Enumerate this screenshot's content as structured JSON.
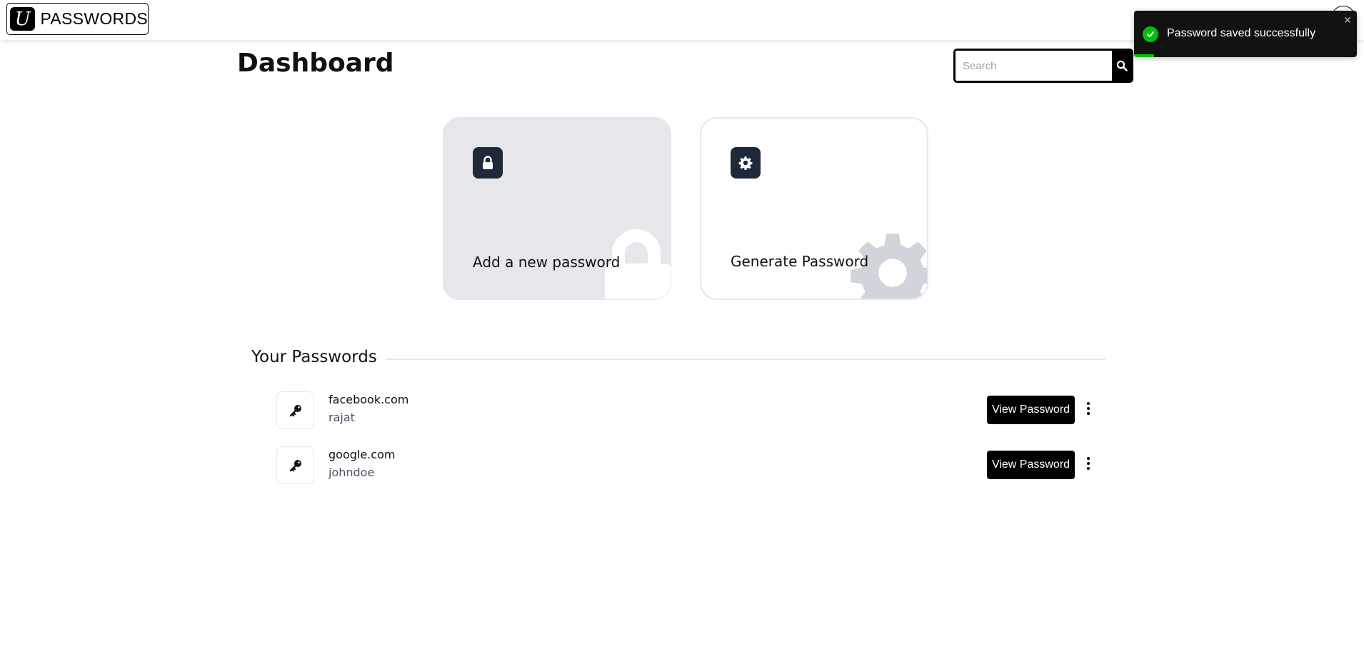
{
  "header": {
    "logo_letter": "U",
    "logo_text": "PASSWORDS"
  },
  "page": {
    "title": "Dashboard"
  },
  "search": {
    "placeholder": "Search",
    "value": "",
    "button_icon": "search-icon"
  },
  "cards": [
    {
      "label": "Add a new password",
      "icon": "lock-icon"
    },
    {
      "label": "Generate Password",
      "icon": "gear-icon"
    }
  ],
  "passwords_section": {
    "title": "Your Passwords",
    "items": [
      {
        "site": "facebook.com",
        "username": "rajat",
        "button_label": "View Password",
        "icon": "key-icon"
      },
      {
        "site": "google.com",
        "username": "johndoe",
        "button_label": "View Password",
        "icon": "key-icon"
      }
    ]
  },
  "toast": {
    "message": "Password saved successfully",
    "close_symbol": "✕",
    "status": "success",
    "progress_fraction": 0.09
  },
  "colors": {
    "accent": "#000000",
    "card_icon_bg": "#1f2937",
    "success": "#07bc0c",
    "toast_bg": "#121212"
  }
}
